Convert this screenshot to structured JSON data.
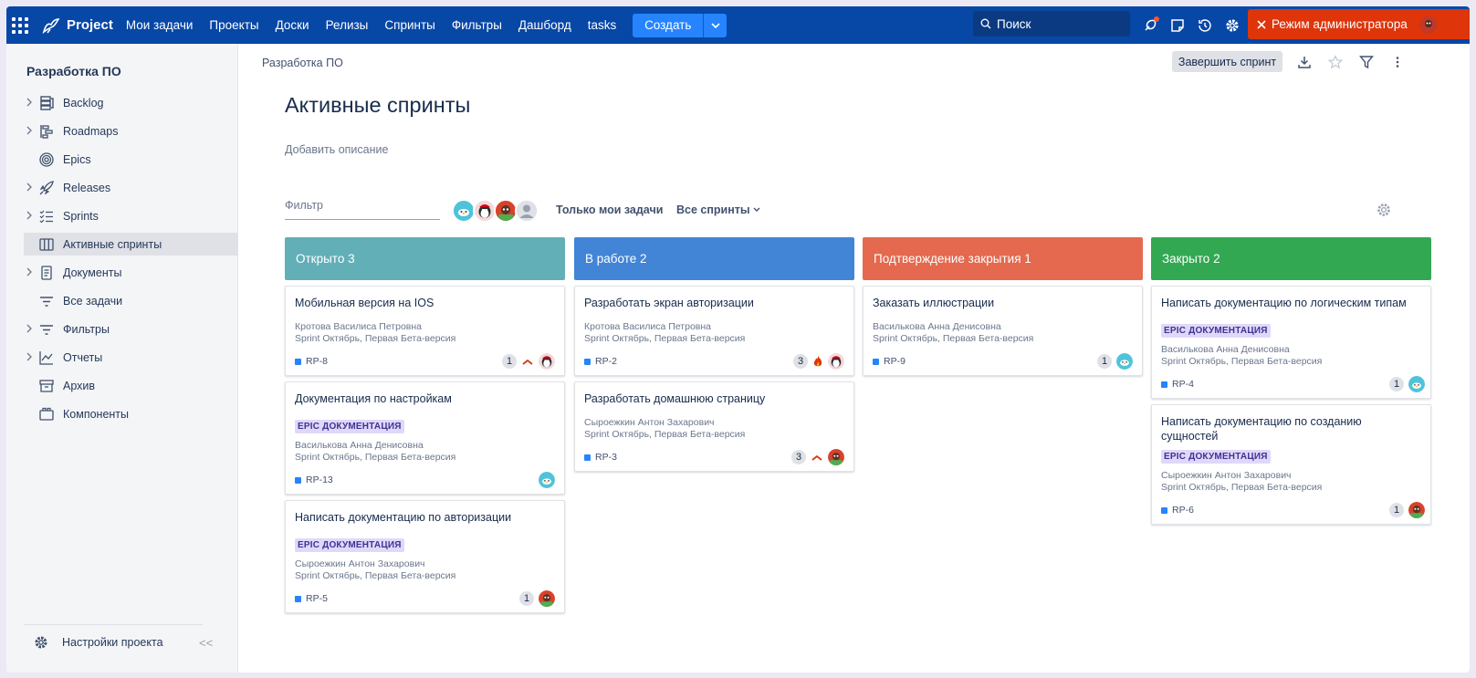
{
  "topbar": {
    "logo_text": "Project",
    "nav": [
      "Мои задачи",
      "Проекты",
      "Доски",
      "Релизы",
      "Спринты",
      "Фильтры",
      "Дашборд",
      "tasks"
    ],
    "create_label": "Создать",
    "search_placeholder": "Поиск",
    "admin_label": "Режим администратора"
  },
  "sidebar": {
    "project_name": "Разработка ПО",
    "items": [
      {
        "label": "Backlog",
        "icon": "backlog-icon",
        "chevron": true
      },
      {
        "label": "Roadmaps",
        "icon": "roadmap-icon",
        "chevron": true
      },
      {
        "label": "Epics",
        "icon": "target-icon",
        "chevron": false
      },
      {
        "label": "Releases",
        "icon": "rocket-icon",
        "chevron": true
      },
      {
        "label": "Sprints",
        "icon": "checklist-icon",
        "chevron": true
      },
      {
        "label": "Активные спринты",
        "icon": "board-icon",
        "chevron": false,
        "active": true
      },
      {
        "label": "Документы",
        "icon": "document-icon",
        "chevron": true
      },
      {
        "label": "Все задачи",
        "icon": "filter-lines-icon",
        "chevron": false
      },
      {
        "label": "Фильтры",
        "icon": "filter-lines-icon",
        "chevron": true
      },
      {
        "label": "Отчеты",
        "icon": "chart-line-icon",
        "chevron": true
      },
      {
        "label": "Архив",
        "icon": "archive-icon",
        "chevron": false
      },
      {
        "label": "Компоненты",
        "icon": "components-icon",
        "chevron": false
      }
    ],
    "settings_label": "Настройки проекта",
    "collapse_label": "<<"
  },
  "main": {
    "breadcrumb": "Разработка ПО",
    "complete_sprint_label": "Завершить спринт",
    "title": "Активные спринты",
    "add_description": "Добавить описание",
    "filter_placeholder": "Фильтр",
    "only_mine_label": "Только мои задачи",
    "all_sprints_label": "Все спринты"
  },
  "colors": {
    "open": "#62afb8",
    "in_progress": "#4285d6",
    "confirm": "#e4694f",
    "closed": "#33a853"
  },
  "columns": [
    {
      "title": "Открыто 3",
      "color": "#62afb8",
      "cards": [
        {
          "title": "Мобильная версия на IOS",
          "epic": "",
          "assignee": "Кротова Василиса Петровна",
          "sprint": "Sprint Октябрь, Первая Бета-версия",
          "key": "RP-8",
          "count": "1",
          "priority": "high",
          "avatar": "penguin"
        },
        {
          "title": "Документация по настройкам",
          "epic": "EPIC ДОКУМЕНТАЦИЯ",
          "assignee": "Василькова Анна Денисовна",
          "sprint": "Sprint Октябрь, Первая Бета-версия",
          "key": "RP-13",
          "count": "",
          "priority": "",
          "avatar": "teal"
        },
        {
          "title": "Написать документацию по авторизации",
          "epic": "EPIC ДОКУМЕНТАЦИЯ",
          "assignee": "Сыроежкин Антон Захарович",
          "sprint": "Sprint Октябрь, Первая Бета-версия",
          "key": "RP-5",
          "count": "1",
          "priority": "",
          "avatar": "red"
        }
      ]
    },
    {
      "title": "В работе 2",
      "color": "#4285d6",
      "cards": [
        {
          "title": "Разработать экран авторизации",
          "epic": "",
          "assignee": "Кротова Василиса Петровна",
          "sprint": "Sprint Октябрь, Первая Бета-версия",
          "key": "RP-2",
          "count": "3",
          "priority": "fire",
          "avatar": "penguin"
        },
        {
          "title": "Разработать домашнюю страницу",
          "epic": "",
          "assignee": "Сыроежкин Антон Захарович",
          "sprint": "Sprint Октябрь, Первая Бета-версия",
          "key": "RP-3",
          "count": "3",
          "priority": "high",
          "avatar": "red"
        }
      ]
    },
    {
      "title": "Подтверждение закрытия 1",
      "color": "#e4694f",
      "cards": [
        {
          "title": "Заказать иллюстрации",
          "epic": "",
          "assignee": "Василькова Анна Денисовна",
          "sprint": "Sprint Октябрь, Первая Бета-версия",
          "key": "RP-9",
          "count": "1",
          "priority": "",
          "avatar": "teal"
        }
      ]
    },
    {
      "title": "Закрыто 2",
      "color": "#33a853",
      "cards": [
        {
          "title": "Написать документацию по логическим типам",
          "epic": "EPIC ДОКУМЕНТАЦИЯ",
          "assignee": "Василькова Анна Денисовна",
          "sprint": "Sprint Октябрь, Первая Бета-версия",
          "key": "RP-4",
          "count": "1",
          "priority": "",
          "avatar": "teal"
        },
        {
          "title": "Написать документацию по созданию сущностей",
          "epic": "EPIC ДОКУМЕНТАЦИЯ",
          "assignee": "Сыроежкин Антон Захарович",
          "sprint": "Sprint Октябрь, Первая Бета-версия",
          "key": "RP-6",
          "count": "1",
          "priority": "",
          "avatar": "red"
        }
      ]
    }
  ]
}
